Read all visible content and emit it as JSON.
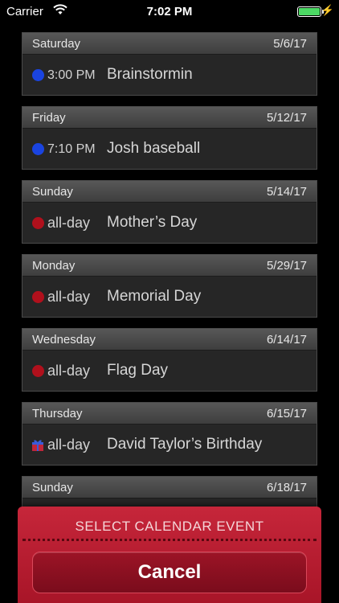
{
  "status_bar": {
    "carrier": "Carrier",
    "time": "7:02 PM",
    "battery_level": 1.0
  },
  "events": [
    {
      "day": "Saturday",
      "date": "5/6/17",
      "time": "3:00 PM",
      "title": "Brainstormin",
      "marker": "dot",
      "color": "#1a44e0"
    },
    {
      "day": "Friday",
      "date": "5/12/17",
      "time": "7:10 PM",
      "title": "Josh baseball",
      "marker": "dot",
      "color": "#1a44e0"
    },
    {
      "day": "Sunday",
      "date": "5/14/17",
      "time": "all-day",
      "title": "Mother’s Day",
      "marker": "dot",
      "color": "#b0101c"
    },
    {
      "day": "Monday",
      "date": "5/29/17",
      "time": "all-day",
      "title": "Memorial Day",
      "marker": "dot",
      "color": "#b0101c"
    },
    {
      "day": "Wednesday",
      "date": "6/14/17",
      "time": "all-day",
      "title": "Flag Day",
      "marker": "dot",
      "color": "#b0101c"
    },
    {
      "day": "Thursday",
      "date": "6/15/17",
      "time": "all-day",
      "title": "David Taylor’s Birthday",
      "marker": "gift-icon",
      "color": "#c0263a"
    },
    {
      "day": "Sunday",
      "date": "6/18/17",
      "time": "",
      "title": "",
      "marker": "",
      "color": ""
    }
  ],
  "action_sheet": {
    "title": "SELECT CALENDAR EVENT",
    "cancel_label": "Cancel"
  }
}
